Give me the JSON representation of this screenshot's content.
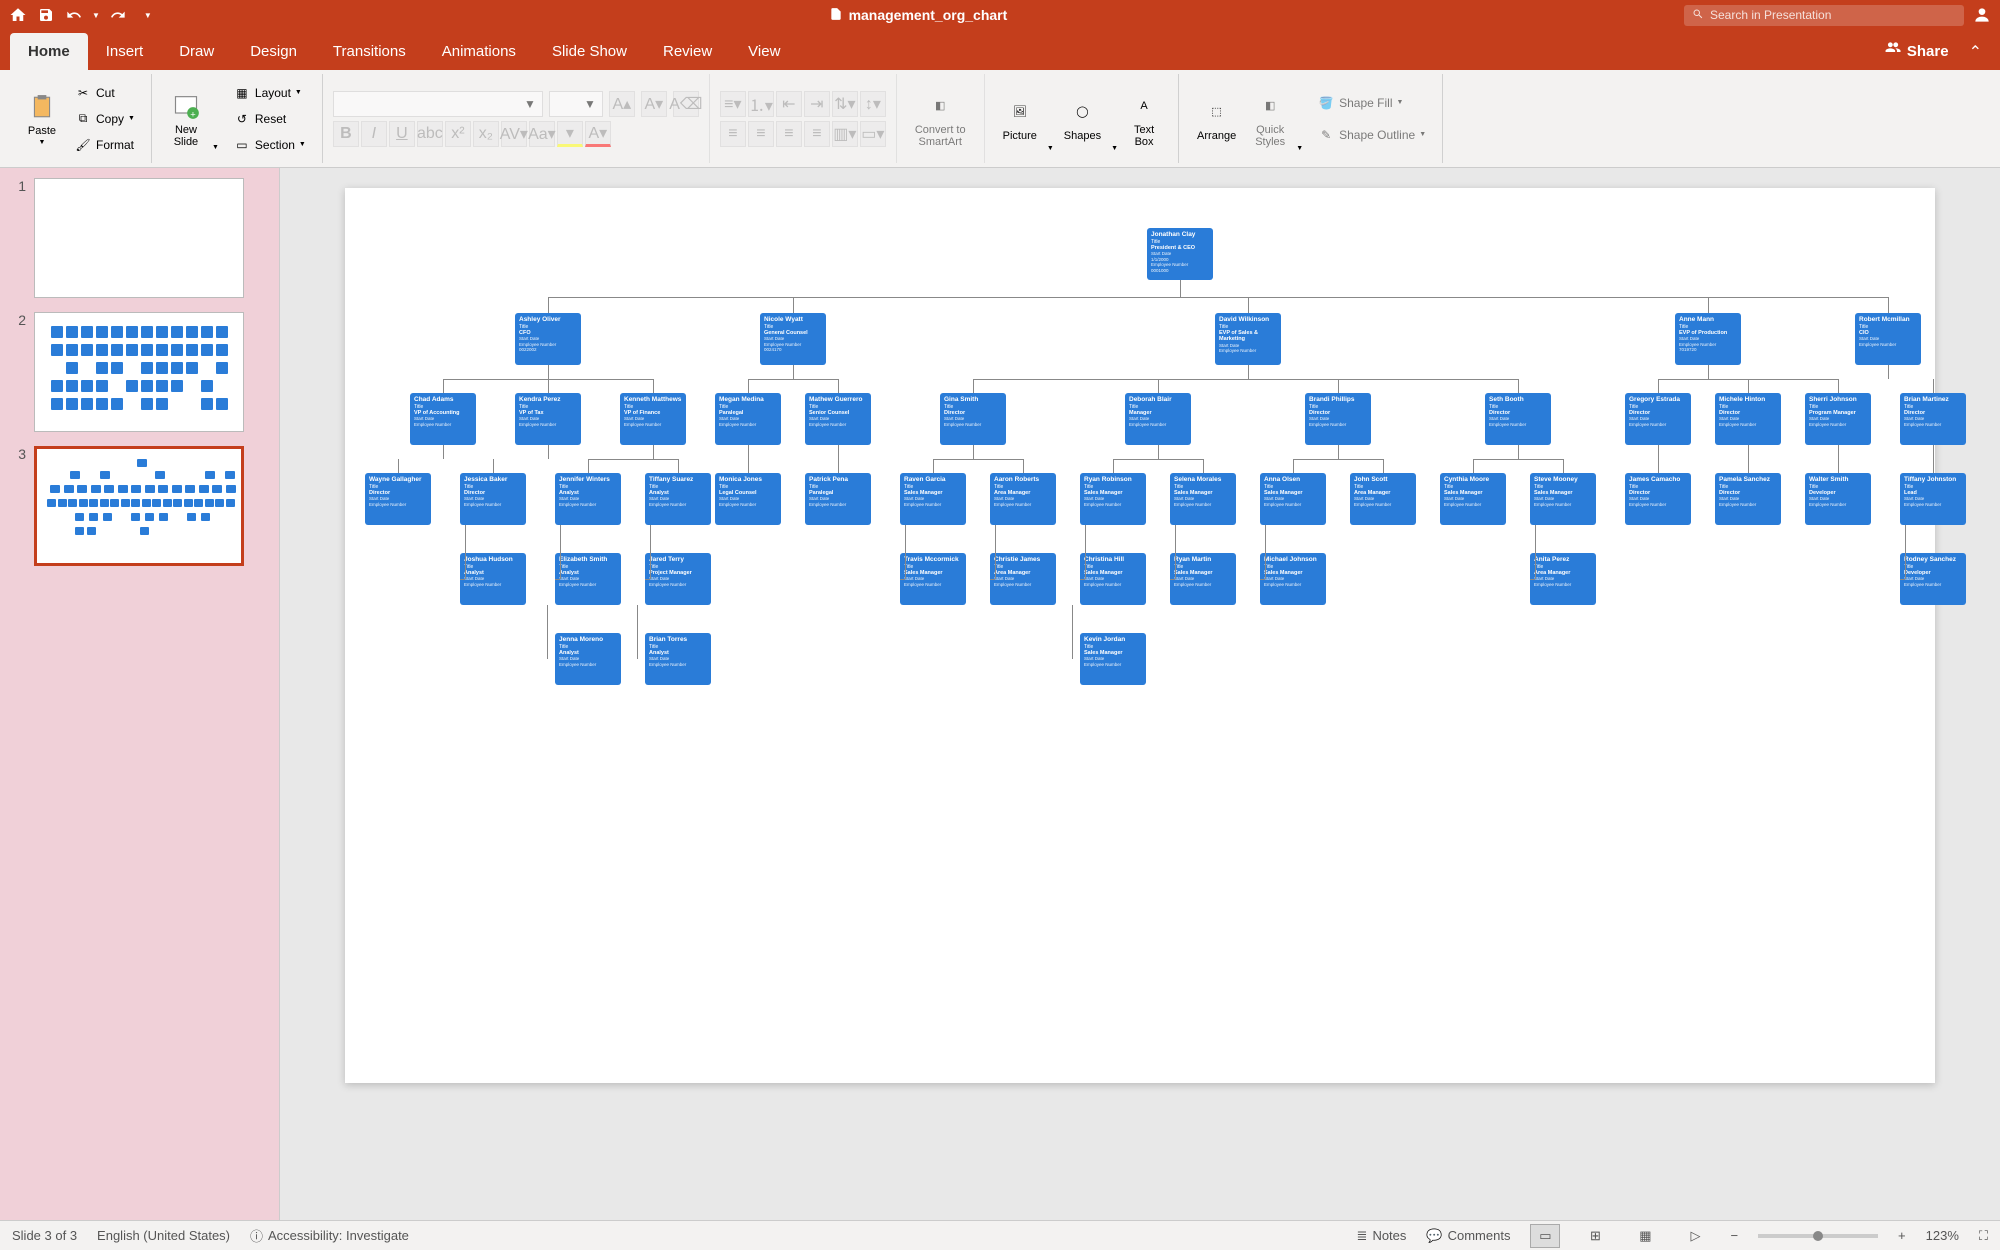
{
  "titlebar": {
    "filename": "management_org_chart",
    "search_placeholder": "Search in Presentation"
  },
  "tabs": [
    "Home",
    "Insert",
    "Draw",
    "Design",
    "Transitions",
    "Animations",
    "Slide Show",
    "Review",
    "View"
  ],
  "active_tab": "Home",
  "share_label": "Share",
  "ribbon": {
    "paste": "Paste",
    "cut": "Cut",
    "copy": "Copy",
    "format": "Format",
    "new_slide": "New\nSlide",
    "layout": "Layout",
    "reset": "Reset",
    "section": "Section",
    "convert": "Convert to\nSmartArt",
    "picture": "Picture",
    "shapes": "Shapes",
    "textbox": "Text\nBox",
    "arrange": "Arrange",
    "quick_styles": "Quick\nStyles",
    "shape_fill": "Shape Fill",
    "shape_outline": "Shape Outline"
  },
  "slides": {
    "count": 3,
    "selected": 3
  },
  "org": {
    "root": {
      "name": "Jonathan Clay",
      "title": "Title",
      "dept": "President & CEO",
      "f1": "Start Date",
      "f2": "1/1/2000",
      "f3": "Employee Number",
      "f4": "0001000"
    },
    "level2": [
      {
        "name": "Ashley Oliver",
        "title": "Title",
        "dept": "CFO",
        "f1": "Start Date",
        "f2": "",
        "f3": "Employee Number",
        "f4": "0022002"
      },
      {
        "name": "Nicole Wyatt",
        "title": "Title",
        "dept": "General Counsel",
        "f1": "Start Date",
        "f2": "",
        "f3": "Employee Number",
        "f4": "0024170"
      },
      {
        "name": "David Wilkinson",
        "title": "Title",
        "dept": "EVP of Sales & Marketing",
        "f1": "Start Date",
        "f2": "",
        "f3": "Employee Number",
        "f4": ""
      },
      {
        "name": "Anne Mann",
        "title": "Title",
        "dept": "EVP of Production",
        "f1": "Start Date",
        "f2": "",
        "f3": "Employee Number",
        "f4": "7019720"
      },
      {
        "name": "Robert Mcmillan",
        "title": "Title",
        "dept": "CIO",
        "f1": "Start Date",
        "f2": "",
        "f3": "Employee Number",
        "f4": ""
      }
    ],
    "level3": [
      {
        "name": "Chad Adams",
        "title": "Title",
        "dept": "VP of Accounting",
        "parent": 0
      },
      {
        "name": "Kendra Perez",
        "title": "Title",
        "dept": "VP of Tax",
        "parent": 0
      },
      {
        "name": "Kenneth Matthews",
        "title": "Title",
        "dept": "VP of Finance",
        "parent": 0
      },
      {
        "name": "Megan Medina",
        "title": "Title",
        "dept": "Paralegal",
        "parent": 1
      },
      {
        "name": "Mathew Guerrero",
        "title": "Title",
        "dept": "Senior Counsel",
        "parent": 1
      },
      {
        "name": "Gina Smith",
        "title": "Title",
        "dept": "Director",
        "parent": 2
      },
      {
        "name": "Deborah Blair",
        "title": "Title",
        "dept": "Manager",
        "parent": 2
      },
      {
        "name": "Brandi Phillips",
        "title": "Title",
        "dept": "Director",
        "parent": 2
      },
      {
        "name": "Seth Booth",
        "title": "Title",
        "dept": "Director",
        "parent": 2
      },
      {
        "name": "Gregory Estrada",
        "title": "Title",
        "dept": "Director",
        "parent": 3
      },
      {
        "name": "Michele Hinton",
        "title": "Title",
        "dept": "Director",
        "parent": 3
      },
      {
        "name": "Sherri Johnson",
        "title": "Title",
        "dept": "Program Manager",
        "parent": 3
      },
      {
        "name": "Brian Martinez",
        "title": "Title",
        "dept": "Director",
        "parent": 4
      }
    ],
    "level4": [
      {
        "name": "Wayne Gallagher",
        "dept": "Director",
        "parent": 0
      },
      {
        "name": "Jessica Baker",
        "dept": "Director",
        "parent": 1
      },
      {
        "name": "Jennifer Winters",
        "dept": "Analyst",
        "parent": 2
      },
      {
        "name": "Tiffany Suarez",
        "dept": "Analyst",
        "parent": 2
      },
      {
        "name": "Monica Jones",
        "dept": "Legal Counsel",
        "parent": 3
      },
      {
        "name": "Patrick Pena",
        "dept": "Paralegal",
        "parent": 4
      },
      {
        "name": "Raven Garcia",
        "dept": "Sales Manager",
        "parent": 5
      },
      {
        "name": "Aaron Roberts",
        "dept": "Area Manager",
        "parent": 5
      },
      {
        "name": "Ryan Robinson",
        "dept": "Sales Manager",
        "parent": 6
      },
      {
        "name": "Selena Morales",
        "dept": "Sales Manager",
        "parent": 6
      },
      {
        "name": "Anna Olsen",
        "dept": "Sales Manager",
        "parent": 7
      },
      {
        "name": "John Scott",
        "dept": "Area Manager",
        "parent": 7
      },
      {
        "name": "Cynthia Moore",
        "dept": "Sales Manager",
        "parent": 8
      },
      {
        "name": "Steve Mooney",
        "dept": "Sales Manager",
        "parent": 8
      },
      {
        "name": "James Camacho",
        "dept": "Director",
        "parent": 9
      },
      {
        "name": "Pamela Sanchez",
        "dept": "Director",
        "parent": 10
      },
      {
        "name": "Walter Smith",
        "dept": "Developer",
        "parent": 11
      },
      {
        "name": "Tiffany Johnston",
        "dept": "Lead",
        "parent": 12
      }
    ],
    "level5": [
      {
        "name": "Joshua Hudson",
        "dept": "Analyst",
        "parent": 1
      },
      {
        "name": "Elizabeth Smith",
        "dept": "Analyst",
        "parent": 2
      },
      {
        "name": "Jared Terry",
        "dept": "Project Manager",
        "parent": 3
      },
      {
        "name": "Travis Mccormick",
        "dept": "Sales Manager",
        "parent": 6
      },
      {
        "name": "Christie James",
        "dept": "Area Manager",
        "parent": 7
      },
      {
        "name": "Christina Hill",
        "dept": "Sales Manager",
        "parent": 8
      },
      {
        "name": "Ryan Martin",
        "dept": "Sales Manager",
        "parent": 9
      },
      {
        "name": "Michael Johnson",
        "dept": "Sales Manager",
        "parent": 10
      },
      {
        "name": "Anita Perez",
        "dept": "Area Manager",
        "parent": 13
      },
      {
        "name": "Rodney Sanchez",
        "dept": "Developer",
        "parent": 17
      }
    ],
    "level6": [
      {
        "name": "Jenna Moreno",
        "dept": "Analyst",
        "parent": 1
      },
      {
        "name": "Brian Torres",
        "dept": "Analyst",
        "parent": 2
      },
      {
        "name": "Kevin Jordan",
        "dept": "Sales Manager",
        "parent": 5
      }
    ]
  },
  "status": {
    "slide_info": "Slide 3 of 3",
    "language": "English (United States)",
    "accessibility": "Accessibility: Investigate",
    "notes": "Notes",
    "comments": "Comments",
    "zoom": "123%"
  }
}
